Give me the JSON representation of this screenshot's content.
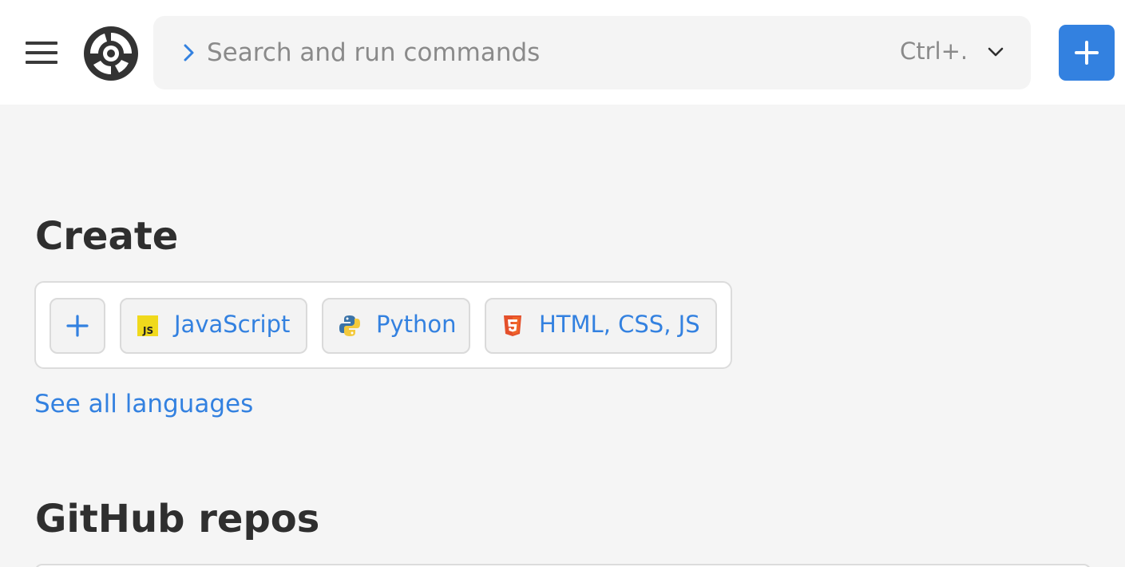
{
  "header": {
    "search": {
      "placeholder": "Search and run commands",
      "shortcut": "Ctrl+."
    }
  },
  "colors": {
    "accent": "#3381e0",
    "header_bg": "#ffffff",
    "page_bg": "#f5f5f5",
    "text": "#2f2f2f"
  },
  "icons": {
    "menu": "hamburger-icon",
    "logo": "replit-logo-icon",
    "search_prompt": "chevron-right-icon",
    "dropdown": "chevron-down-icon",
    "add": "plus-icon"
  },
  "create": {
    "title": "Create",
    "languages": [
      {
        "label": "JavaScript",
        "icon": "javascript-icon"
      },
      {
        "label": "Python",
        "icon": "python-icon"
      },
      {
        "label": "HTML, CSS, JS",
        "icon": "html5-icon"
      }
    ],
    "see_all": "See all languages"
  },
  "github": {
    "title": "GitHub repos"
  }
}
